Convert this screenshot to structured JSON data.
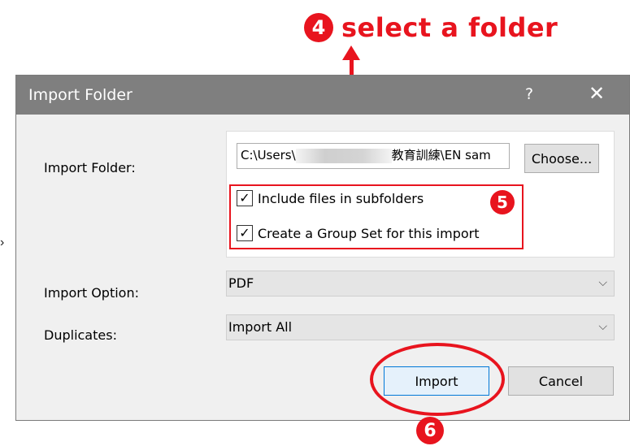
{
  "annotations": {
    "step4_number": "4",
    "step4_text": "select a folder",
    "step5_number": "5",
    "step6_number": "6",
    "side_mark": "›"
  },
  "dialog": {
    "title": "Import Folder",
    "help_label": "?",
    "close_label": "✕",
    "folder_label": "Import Folder:",
    "path_prefix": "C:\\Users\\",
    "path_suffix": "教育訓練\\EN sam",
    "choose_label": "Choose...",
    "include_subfolders": {
      "label": "Include files in subfolders",
      "checked": true,
      "mark": "✓"
    },
    "create_group_set": {
      "label": "Create a Group Set for this import",
      "checked": true,
      "mark": "✓"
    },
    "import_option_label": "Import Option:",
    "import_option_value": "PDF",
    "duplicates_label": "Duplicates:",
    "duplicates_value": "Import All",
    "chevron": "⌵",
    "import_button": "Import",
    "cancel_button": "Cancel"
  },
  "colors": {
    "accent_red": "#e8141e",
    "titlebar": "#7f7f7f",
    "dialog_bg": "#f0f0f0",
    "default_button_border": "#0078d7"
  }
}
